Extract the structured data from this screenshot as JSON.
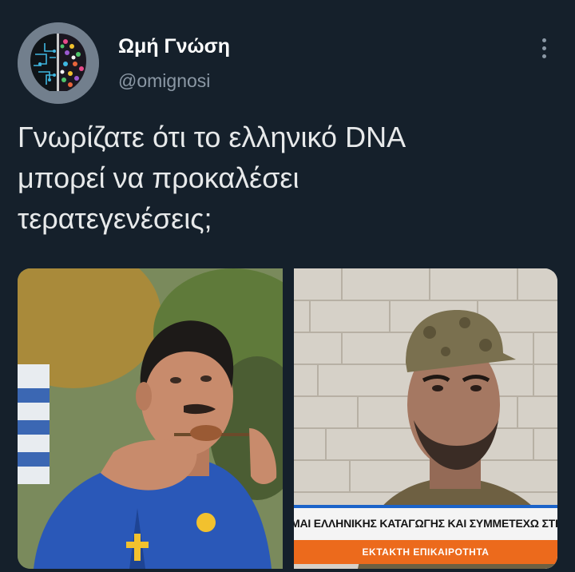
{
  "tweet": {
    "author": {
      "display_name": "Ωμή Γνώση",
      "handle": "@omignosi",
      "avatar_icon": "brain-logo-avatar"
    },
    "more_icon": "more-vertical-icon",
    "text": "Γνωρίζατε ότι το ελληνικό DNA\nμπορεί να προκαλέσει\nτερατεγενέσεις;",
    "media": [
      {
        "description_icon": "photo-man-eating-souvlaki"
      },
      {
        "description_icon": "photo-soldier-tv-interview",
        "ticker_text": "ΜΑΙ ΕΛΛΗΝΙΚΗΣ ΚΑΤΑΓΩΓΗΣ ΚΑΙ ΣΥΜΜΕΤΕΧΩ ΣΤΗΝ ΑΜΥΝΑ ΤΗΣ Ι",
        "flash_text": "ΕΚΤΑΚΤΗ ΕΠΙΚΑΙΡΟΤΗΤΑ"
      }
    ]
  },
  "colors": {
    "background": "#15202b",
    "text": "#e7e9ea",
    "secondary": "#8b98a5",
    "ticker_accent": "#ec6a1c"
  }
}
